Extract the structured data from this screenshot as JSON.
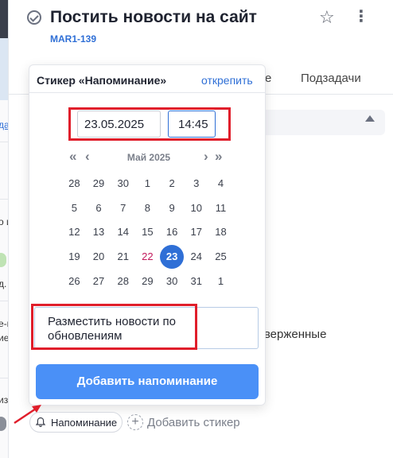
{
  "task": {
    "title": "Постить новости на сайт",
    "key": "MAR1-139"
  },
  "background": {
    "tab_partial": "е",
    "tab_subtasks": "Подзадачи",
    "text_partial": "тверженные",
    "sidebar_fragments": [
      "да",
      "о и",
      "д.",
      "е-п",
      "ие",
      "из,"
    ]
  },
  "sticker_popup": {
    "title": "Стикер «Напоминание»",
    "unpin_label": "открепить",
    "date_value": "23.05.2025",
    "time_value": "14:45",
    "calendar": {
      "prev_year_icon": "«",
      "prev_month_icon": "‹",
      "month_label": "Май 2025",
      "next_month_icon": "›",
      "next_year_icon": "»",
      "weeks": [
        [
          "28",
          "29",
          "30",
          "1",
          "2",
          "3",
          "4"
        ],
        [
          "5",
          "6",
          "7",
          "8",
          "9",
          "10",
          "11"
        ],
        [
          "12",
          "13",
          "14",
          "15",
          "16",
          "17",
          "18"
        ],
        [
          "19",
          "20",
          "21",
          "22",
          "23",
          "24",
          "25"
        ],
        [
          "26",
          "27",
          "28",
          "29",
          "30",
          "31",
          "1"
        ]
      ],
      "selected_day": "23",
      "highlighted_day": "22"
    },
    "reminder_text": "Разместить новости по обновлениям",
    "add_button_label": "Добавить напоминание"
  },
  "bottom_bar": {
    "reminder_chip_label": "Напоминание",
    "add_sticker_label": "Добавить стикер"
  },
  "colors": {
    "accent": "#2f6fd6",
    "button": "#4a90f7",
    "annotation_red": "#e01e2b",
    "holiday": "#c2185b"
  }
}
